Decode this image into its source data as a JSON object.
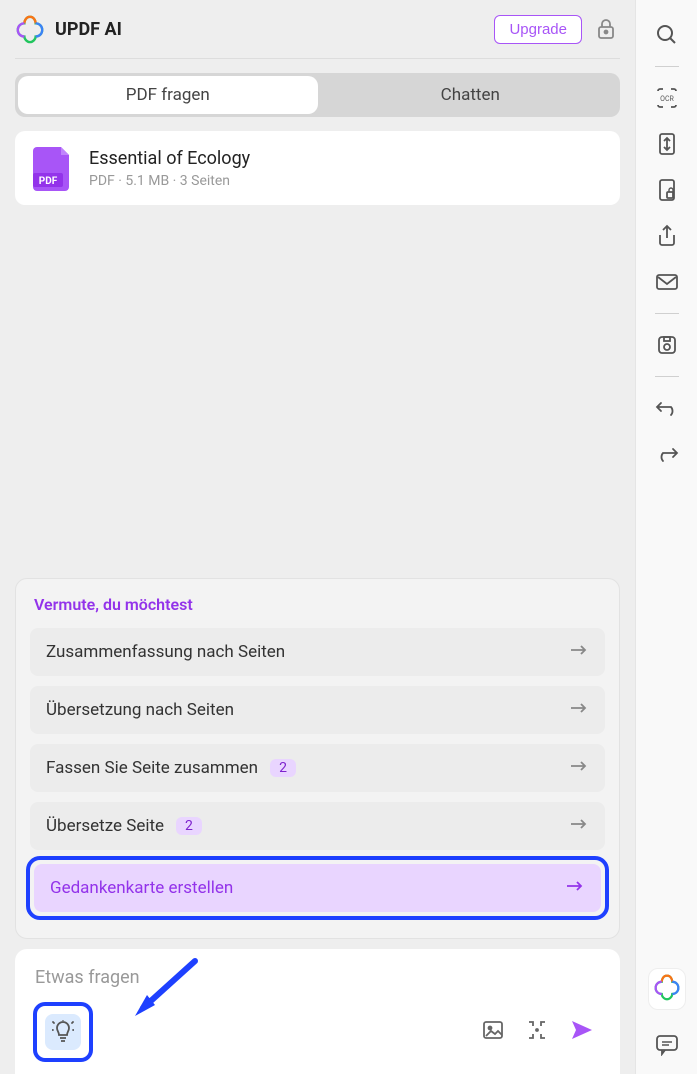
{
  "header": {
    "title": "UPDF AI",
    "upgrade": "Upgrade"
  },
  "tabs": {
    "ask": "PDF fragen",
    "chat": "Chatten"
  },
  "file": {
    "name": "Essential of Ecology",
    "meta": "PDF · 5.1 MB · 3 Seiten"
  },
  "suggest": {
    "title": "Vermute, du möchtest",
    "items": [
      {
        "label": "Zusammenfassung nach Seiten"
      },
      {
        "label": "Übersetzung nach Seiten"
      },
      {
        "label": "Fassen Sie Seite zusammen",
        "badge": "2"
      },
      {
        "label": "Übersetze Seite",
        "badge": "2"
      },
      {
        "label": "Gedankenkarte erstellen",
        "highlight": true
      }
    ]
  },
  "input": {
    "placeholder": "Etwas fragen"
  }
}
